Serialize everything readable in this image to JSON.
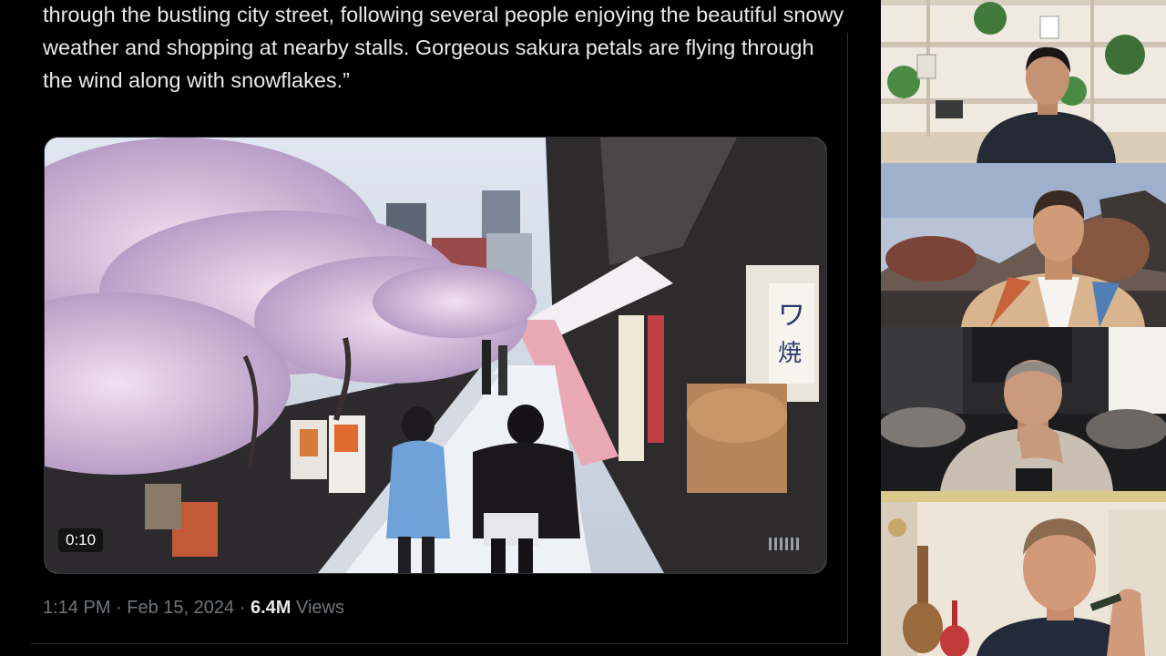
{
  "tweet": {
    "text": "through the bustling city street, following several people enjoying the beautiful snowy weather and shopping at nearby stalls. Gorgeous sakura petals are flying through the wind along with snowflakes.”",
    "time": "1:14 PM",
    "separator": "·",
    "date": "Feb 15, 2024",
    "views_count": "6.4M",
    "views_label": "Views"
  },
  "video": {
    "timecode": "0:10",
    "sign_text": "ワ\n焼"
  },
  "participants": [
    {
      "name_icon": "participant-1"
    },
    {
      "name_icon": "participant-2"
    },
    {
      "name_icon": "participant-3"
    },
    {
      "name_icon": "participant-4"
    }
  ],
  "colors": {
    "background": "#000000",
    "text": "#e7e9ea",
    "muted": "#71767b",
    "border": "#2f3336"
  }
}
